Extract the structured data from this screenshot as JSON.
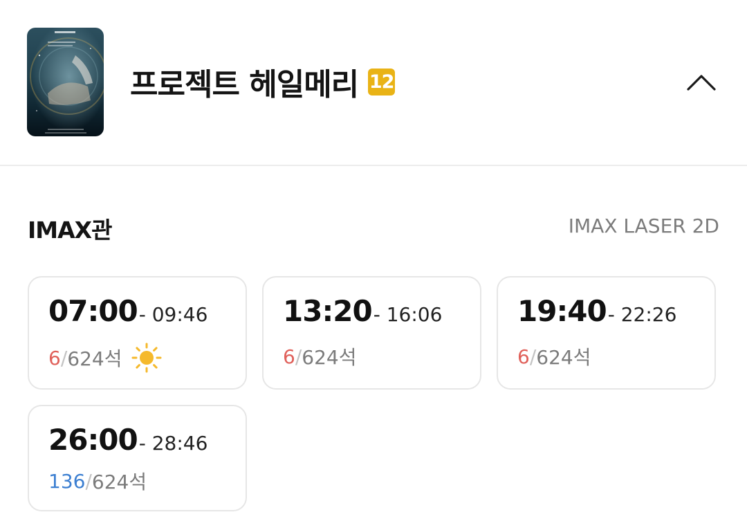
{
  "movie": {
    "title": "프로젝트 헤일메리",
    "age_rating": "12",
    "age_badge_color": "#e9b316",
    "poster_title": "헤일메리",
    "poster_subtitle": "프로젝트",
    "collapse_icon": "chevron-up-icon"
  },
  "screen": {
    "name": "IMAX관",
    "format": "IMAX LASER 2D"
  },
  "showtimes": [
    {
      "start": "07:00",
      "end": "- 09:46",
      "available": "6",
      "separator": "/",
      "total": "624석",
      "avail_color": "red",
      "icon": "sun-icon"
    },
    {
      "start": "13:20",
      "end": "- 16:06",
      "available": "6",
      "separator": "/",
      "total": "624석",
      "avail_color": "red",
      "icon": ""
    },
    {
      "start": "19:40",
      "end": "- 22:26",
      "available": "6",
      "separator": "/",
      "total": "624석",
      "avail_color": "red",
      "icon": ""
    },
    {
      "start": "26:00",
      "end": "- 28:46",
      "available": "136",
      "separator": "/",
      "total": "624석",
      "avail_color": "blue",
      "icon": ""
    }
  ],
  "colors": {
    "seat_red": "#e0605a",
    "seat_blue": "#3c7fd1",
    "sun": "#f5b92c"
  }
}
